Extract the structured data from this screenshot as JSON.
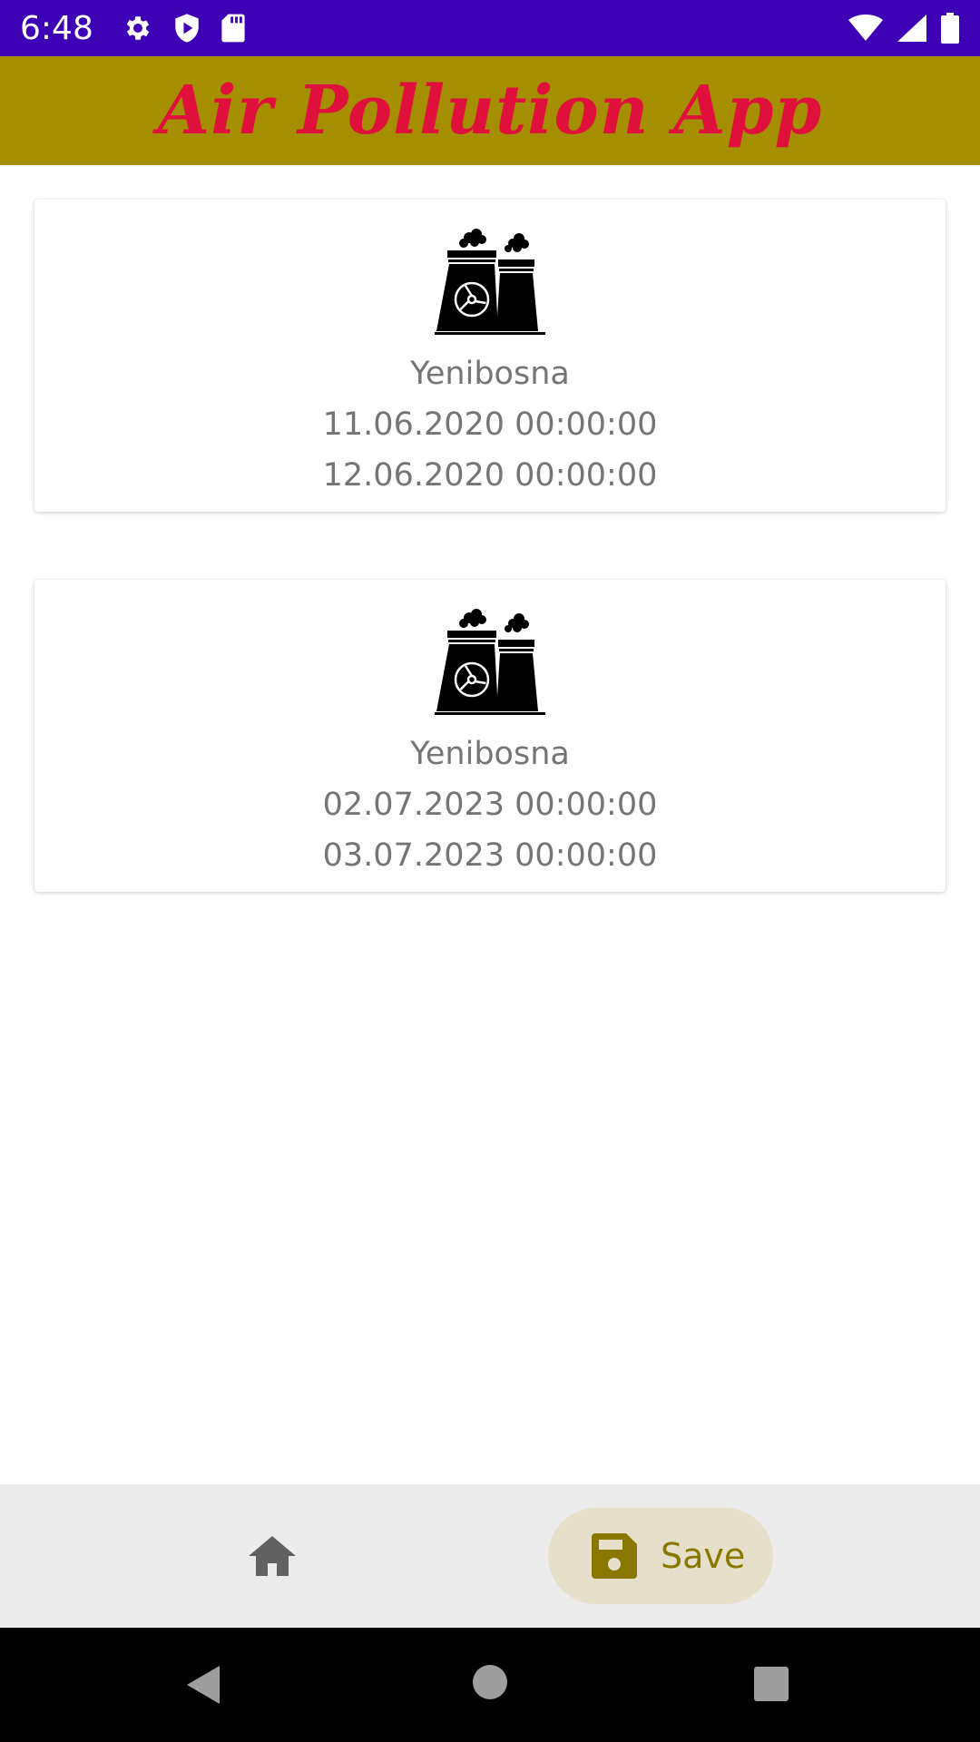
{
  "status_bar": {
    "time": "6:48",
    "icons_left": [
      "settings-gear-icon",
      "shield-play-icon",
      "sd-card-icon"
    ],
    "icons_right": [
      "wifi-icon",
      "signal-icon",
      "battery-icon"
    ],
    "background_color": "#3d00b5"
  },
  "app_bar": {
    "title": "Air Pollution App",
    "background_color": "#a58f00",
    "title_color": "#e0103c"
  },
  "records": [
    {
      "icon": "power-plant-icon",
      "location": "Yenibosna",
      "start": "11.06.2020 00:00:00",
      "end": "12.06.2020 00:00:00"
    },
    {
      "icon": "power-plant-icon",
      "location": "Yenibosna",
      "start": "02.07.2023 00:00:00",
      "end": "03.07.2023 00:00:00"
    }
  ],
  "bottom_nav": {
    "items": [
      {
        "icon": "home-icon",
        "label": "",
        "selected": false
      },
      {
        "icon": "save-icon",
        "label": "Save",
        "selected": true
      }
    ],
    "selected_color": "#8a7700"
  },
  "system_nav": {
    "buttons": [
      "back-triangle-icon",
      "home-circle-icon",
      "recents-square-icon"
    ]
  }
}
